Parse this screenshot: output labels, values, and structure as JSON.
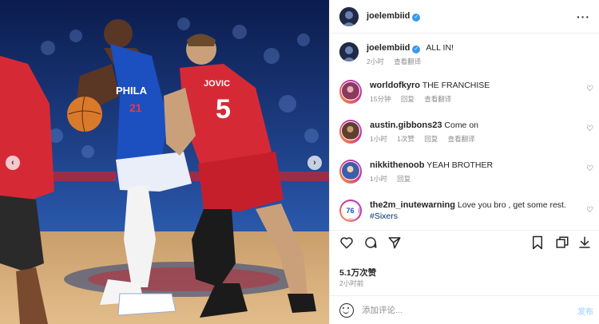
{
  "post": {
    "author": "joelembiid",
    "caption_user": "joelembiid",
    "caption": "ALL IN!",
    "caption_time": "2小时",
    "caption_translate": "查看翻译",
    "likes": "5.1万次赞",
    "time": "2小时前"
  },
  "photo": {
    "jersey_left": "PHILA",
    "jersey_left_number": "21",
    "jersey_right_name": "JOVIC",
    "jersey_right_number": "5"
  },
  "comments": [
    {
      "user": "worldofkyro",
      "text": "THE FRANCHISE",
      "time": "15分钟",
      "reply": "回复",
      "translate": "查看翻译"
    },
    {
      "user": "austin.gibbons23",
      "text": "Come on",
      "time": "1小时",
      "likes": "1次赞",
      "reply": "回复",
      "translate": "查看翻译"
    },
    {
      "user": "nikkithenoob",
      "text": "YEAH BROTHER",
      "time": "1小时",
      "reply": "回复"
    },
    {
      "user": "the2m_inutewarning",
      "text": "Love you bro , get some rest.",
      "hashtag": "#Sixers"
    }
  ],
  "add_comment": {
    "placeholder": "添加评论...",
    "post_label": "发布"
  },
  "icons": {
    "heart": "heart-icon",
    "comment": "comment-icon",
    "share": "share-icon",
    "save": "bookmark-icon",
    "more": "more-icon",
    "emoji": "emoji-icon"
  },
  "colors": {
    "verified": "#3897f0",
    "post_disabled": "#b3dbff",
    "meta": "#8e8e8e"
  }
}
